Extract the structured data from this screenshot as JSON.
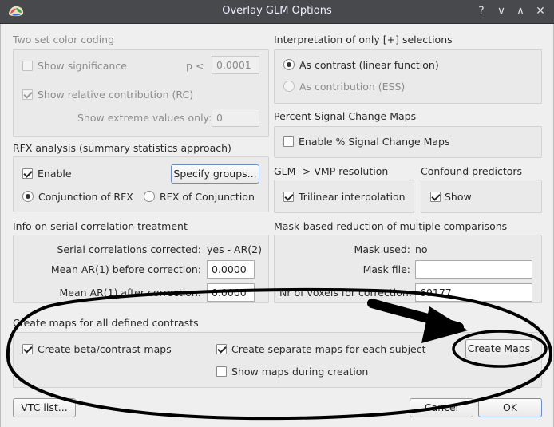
{
  "window": {
    "title": "Overlay GLM Options",
    "controls": {
      "help": "?",
      "minimize": "∨",
      "maximize": "∧",
      "close": "✕"
    }
  },
  "two_set": {
    "title": "Two set color coding",
    "show_significance": {
      "label": "Show significance",
      "checked": false,
      "enabled": false
    },
    "p_label": "p <",
    "p_value": "0.0001",
    "show_rc": {
      "label": "Show relative contribution (RC)",
      "checked": true,
      "enabled": false
    },
    "extreme_label": "Show extreme values only:",
    "extreme_value": "0"
  },
  "interpretation": {
    "title": "Interpretation of only [+] selections",
    "as_contrast": {
      "label": "As contrast (linear function)",
      "selected": true
    },
    "as_contribution": {
      "label": "As contribution (ESS)",
      "selected": false,
      "enabled": false
    }
  },
  "percent_signal": {
    "title": "Percent Signal Change Maps",
    "enable": {
      "label": "Enable % Signal Change Maps",
      "checked": false
    }
  },
  "rfx": {
    "title": "RFX analysis (summary statistics approach)",
    "enable": {
      "label": "Enable",
      "checked": true
    },
    "specify_groups": "Specify groups...",
    "conjunction_rfx": {
      "label": "Conjunction of RFX",
      "selected": true
    },
    "rfx_conjunction": {
      "label": "RFX of Conjunction",
      "selected": false
    }
  },
  "vmp": {
    "title": "GLM -> VMP resolution",
    "trilinear": {
      "label": "Trilinear interpolation",
      "checked": true
    }
  },
  "confound": {
    "title": "Confound predictors",
    "show": {
      "label": "Show",
      "checked": true
    }
  },
  "serial": {
    "title": "Info on serial correlation treatment",
    "corrected_label": "Serial correlations corrected:",
    "corrected_value": "yes - AR(2)",
    "before_label": "Mean AR(1) before correction:",
    "before_value": "0.0000",
    "after_label": "Mean AR(1) after correction:",
    "after_value": "0.0000"
  },
  "mask": {
    "title": "Mask-based reduction of multiple comparisons",
    "used_label": "Mask used:",
    "used_value": "no",
    "file_label": "Mask file:",
    "file_value": "",
    "voxels_label": "Nr of voxels for correction:",
    "voxels_value": "69177"
  },
  "create": {
    "title": "Create maps for all defined contrasts",
    "beta": {
      "label": "Create beta/contrast maps",
      "checked": true
    },
    "separate": {
      "label": "Create separate maps for each subject",
      "checked": true
    },
    "show_during": {
      "label": "Show maps during creation",
      "checked": false
    },
    "create_button": "Create Maps"
  },
  "footer": {
    "vtc_list": "VTC list...",
    "cancel": "Cancel",
    "ok": "OK"
  },
  "colors": {
    "titlebar": "#47494c",
    "dialog_bg": "#efefef",
    "annotation": "#000000"
  }
}
